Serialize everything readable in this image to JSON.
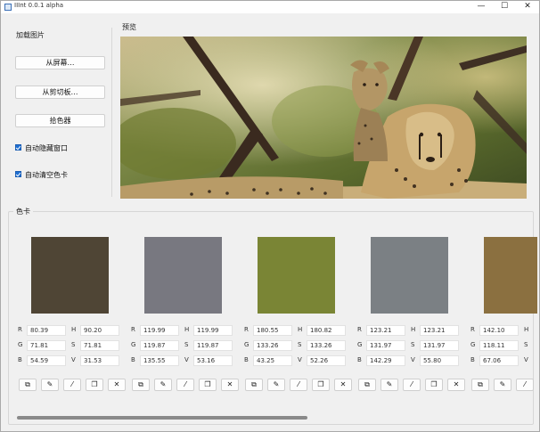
{
  "window": {
    "title": "IIInt 0.0.1 alpha",
    "minimize": "—",
    "maximize": "☐",
    "close": "✕"
  },
  "left": {
    "section_label": "加载图片",
    "btn_screen": "从屏幕…",
    "btn_clipboard": "从剪切板…",
    "btn_picker": "拾色器",
    "chk_hide": "自动隐藏窗口",
    "chk_clear": "自动清空色卡"
  },
  "preview": {
    "label": "预览"
  },
  "palette": {
    "label": "色卡",
    "swatches": [
      {
        "color": "#4f4535",
        "r": "80.39",
        "g": "71.81",
        "b": "54.59",
        "h": "90.20",
        "s": "71.81",
        "v": "31.53"
      },
      {
        "color": "#787880",
        "r": "119.99",
        "g": "119.87",
        "b": "135.55",
        "h": "119.99",
        "s": "119.87",
        "v": "53.16"
      },
      {
        "color": "#7a8535",
        "r": "180.55",
        "g": "133.26",
        "b": "43.25",
        "h": "180.82",
        "s": "133.26",
        "v": "52.26"
      },
      {
        "color": "#7b8084",
        "r": "123.21",
        "g": "131.97",
        "b": "142.29",
        "h": "123.21",
        "s": "131.97",
        "v": "55.80"
      },
      {
        "color": "#8b7040",
        "r": "142.10",
        "g": "118.11",
        "b": "67.06",
        "h": "",
        "s": "",
        "v": ""
      }
    ],
    "tool_icons": [
      "copy-icon",
      "pen-icon",
      "eyedropper-icon",
      "duplicate-icon",
      "close-icon"
    ]
  }
}
